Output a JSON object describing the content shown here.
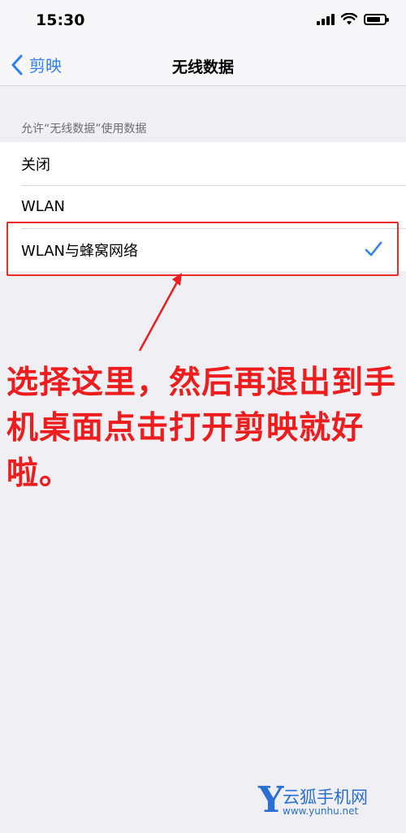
{
  "status_bar": {
    "time": "15:30"
  },
  "nav": {
    "back_label": "剪映",
    "title": "无线数据"
  },
  "section": {
    "header": "允许“无线数据”使用数据",
    "options": [
      {
        "label": "关闭",
        "selected": false
      },
      {
        "label": "WLAN",
        "selected": false
      },
      {
        "label": "WLAN与蜂窝网络",
        "selected": true
      }
    ]
  },
  "annotation": {
    "text": "选择这里，然后再退出到手机桌面点击打开剪映就好啦。",
    "color": "#ee1c1c"
  },
  "watermark": {
    "logo_letter": "Y",
    "name": "云狐手机网",
    "url": "www.yunhu.net"
  },
  "colors": {
    "accent": "#2f7ff6",
    "background": "#efeff4"
  }
}
